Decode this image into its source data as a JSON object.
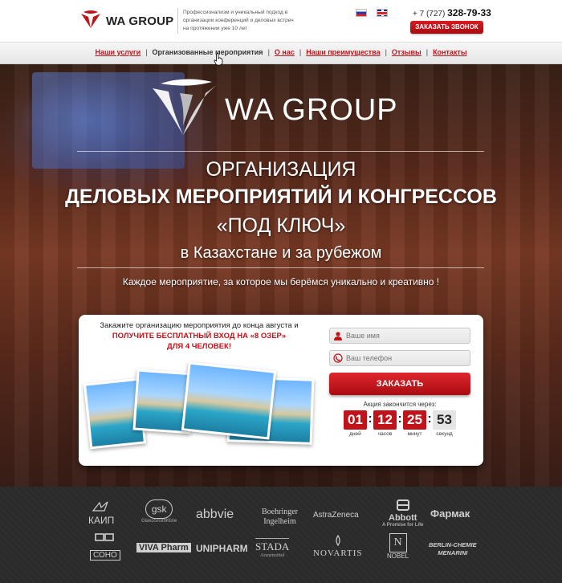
{
  "header": {
    "brand_name": "WA GROUP",
    "tagline": "Профессионализм и уникальный подход в организации конференций и деловых встреч на протяжении уже 10 лет",
    "languages": [
      "ru",
      "en"
    ],
    "phone_prefix": "+ 7 (727)",
    "phone_number": "328-79-33",
    "callback_label": "ЗАКАЗАТЬ ЗВОНОК"
  },
  "nav": {
    "items": [
      {
        "label": "Наши услуги"
      },
      {
        "label": "Организованные мероприятия"
      },
      {
        "label": "О нас"
      },
      {
        "label": "Наши преимущества"
      },
      {
        "label": "Отзывы"
      },
      {
        "label": "Контакты"
      }
    ]
  },
  "hero": {
    "brand_name": "WA GROUP",
    "line1": "ОРГАНИЗАЦИЯ",
    "line2": "ДЕЛОВЫХ МЕРОПРИЯТИЙ И КОНГРЕССОВ",
    "line3": "«ПОД КЛЮЧ»",
    "line4": "в Казахстане и за рубежом",
    "subline": "Каждое мероприятие, за которое мы берёмся уникально и креативно !"
  },
  "offer": {
    "line1": "Закажите организацию мероприятия до конца августа и",
    "line2": "ПОЛУЧИТЕ БЕСПЛАТНЫЙ ВХОД НА «8 ОЗЕР»",
    "line3": "ДЛЯ 4 ЧЕЛОВЕК!"
  },
  "form": {
    "name_placeholder": "Ваше имя",
    "phone_placeholder": "Ваш телефон",
    "submit_label": "ЗАКАЗАТЬ",
    "timer_title": "Акция закончится через:",
    "timer": [
      {
        "value": "01",
        "label": "дней"
      },
      {
        "value": "12",
        "label": "часов"
      },
      {
        "value": "25",
        "label": "минут"
      },
      {
        "value": "53",
        "label": "секунд"
      }
    ]
  },
  "clients": {
    "row1": [
      "КАИП",
      "gsk",
      "GlaxoSmithKline",
      "abbvie",
      "Boehringer",
      "Ingelheim",
      "AstraZeneca",
      "Abbott",
      "A Promise for Life",
      "Фармак"
    ],
    "row2": [
      "СОНО",
      "VIVA Pharm",
      "UNIPHARM",
      "STADA",
      "Arzneimittel",
      "NOVARTIS",
      "NOBEL",
      "BERLIN-CHEMIE",
      "MENARINI"
    ]
  },
  "colors": {
    "accent": "#c0141a",
    "nav_bg": "#ececec",
    "footer_bg": "#2b2b2b"
  }
}
